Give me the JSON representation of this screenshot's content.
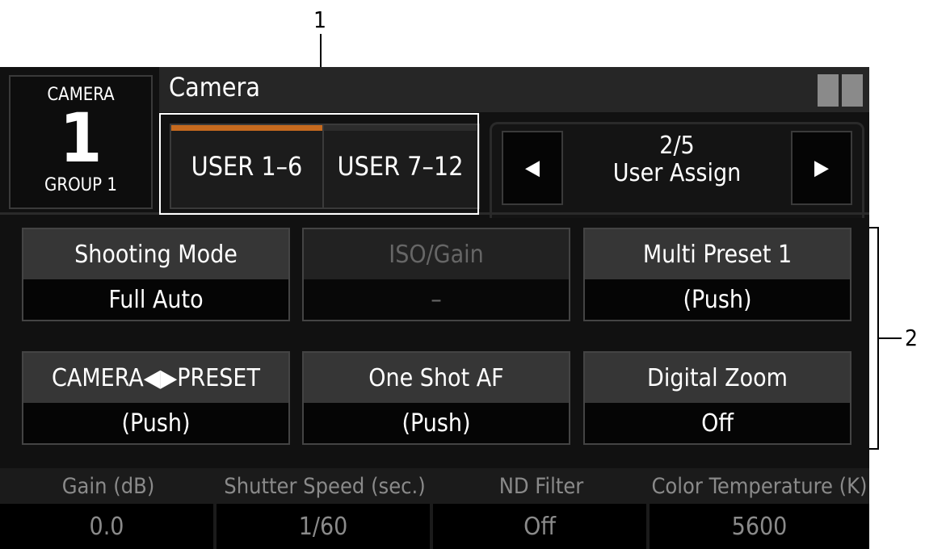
{
  "callouts": {
    "one": "1",
    "two": "2"
  },
  "camera": {
    "label": "CAMERA",
    "number": "1",
    "group": "GROUP 1"
  },
  "header": {
    "title": "Camera"
  },
  "tabs": [
    {
      "label": "USER 1–6",
      "active": true
    },
    {
      "label": "USER 7–12",
      "active": false
    }
  ],
  "pager": {
    "page": "2/5",
    "name": "User Assign",
    "prev_icon": "◀",
    "next_icon": "▶"
  },
  "assignments": [
    {
      "title": "Shooting Mode",
      "value": "Full Auto",
      "enabled": true
    },
    {
      "title": "ISO/Gain",
      "value": "–",
      "enabled": false
    },
    {
      "title": "Multi Preset 1",
      "value": "(Push)",
      "enabled": true
    },
    {
      "title": "CAMERA◀▶PRESET",
      "value": "(Push)",
      "enabled": true
    },
    {
      "title": "One Shot AF",
      "value": "(Push)",
      "enabled": true
    },
    {
      "title": "Digital Zoom",
      "value": "Off",
      "enabled": true
    }
  ],
  "status": [
    {
      "label": "Gain (dB)",
      "value": "0.0"
    },
    {
      "label": "Shutter Speed (sec.)",
      "value": "1/60"
    },
    {
      "label": "ND Filter",
      "value": "Off"
    },
    {
      "label": "Color Temperature (K)",
      "value": "5600"
    }
  ],
  "colors": {
    "accent": "#c76a1e",
    "background": "#111111",
    "button_header": "#363636"
  }
}
